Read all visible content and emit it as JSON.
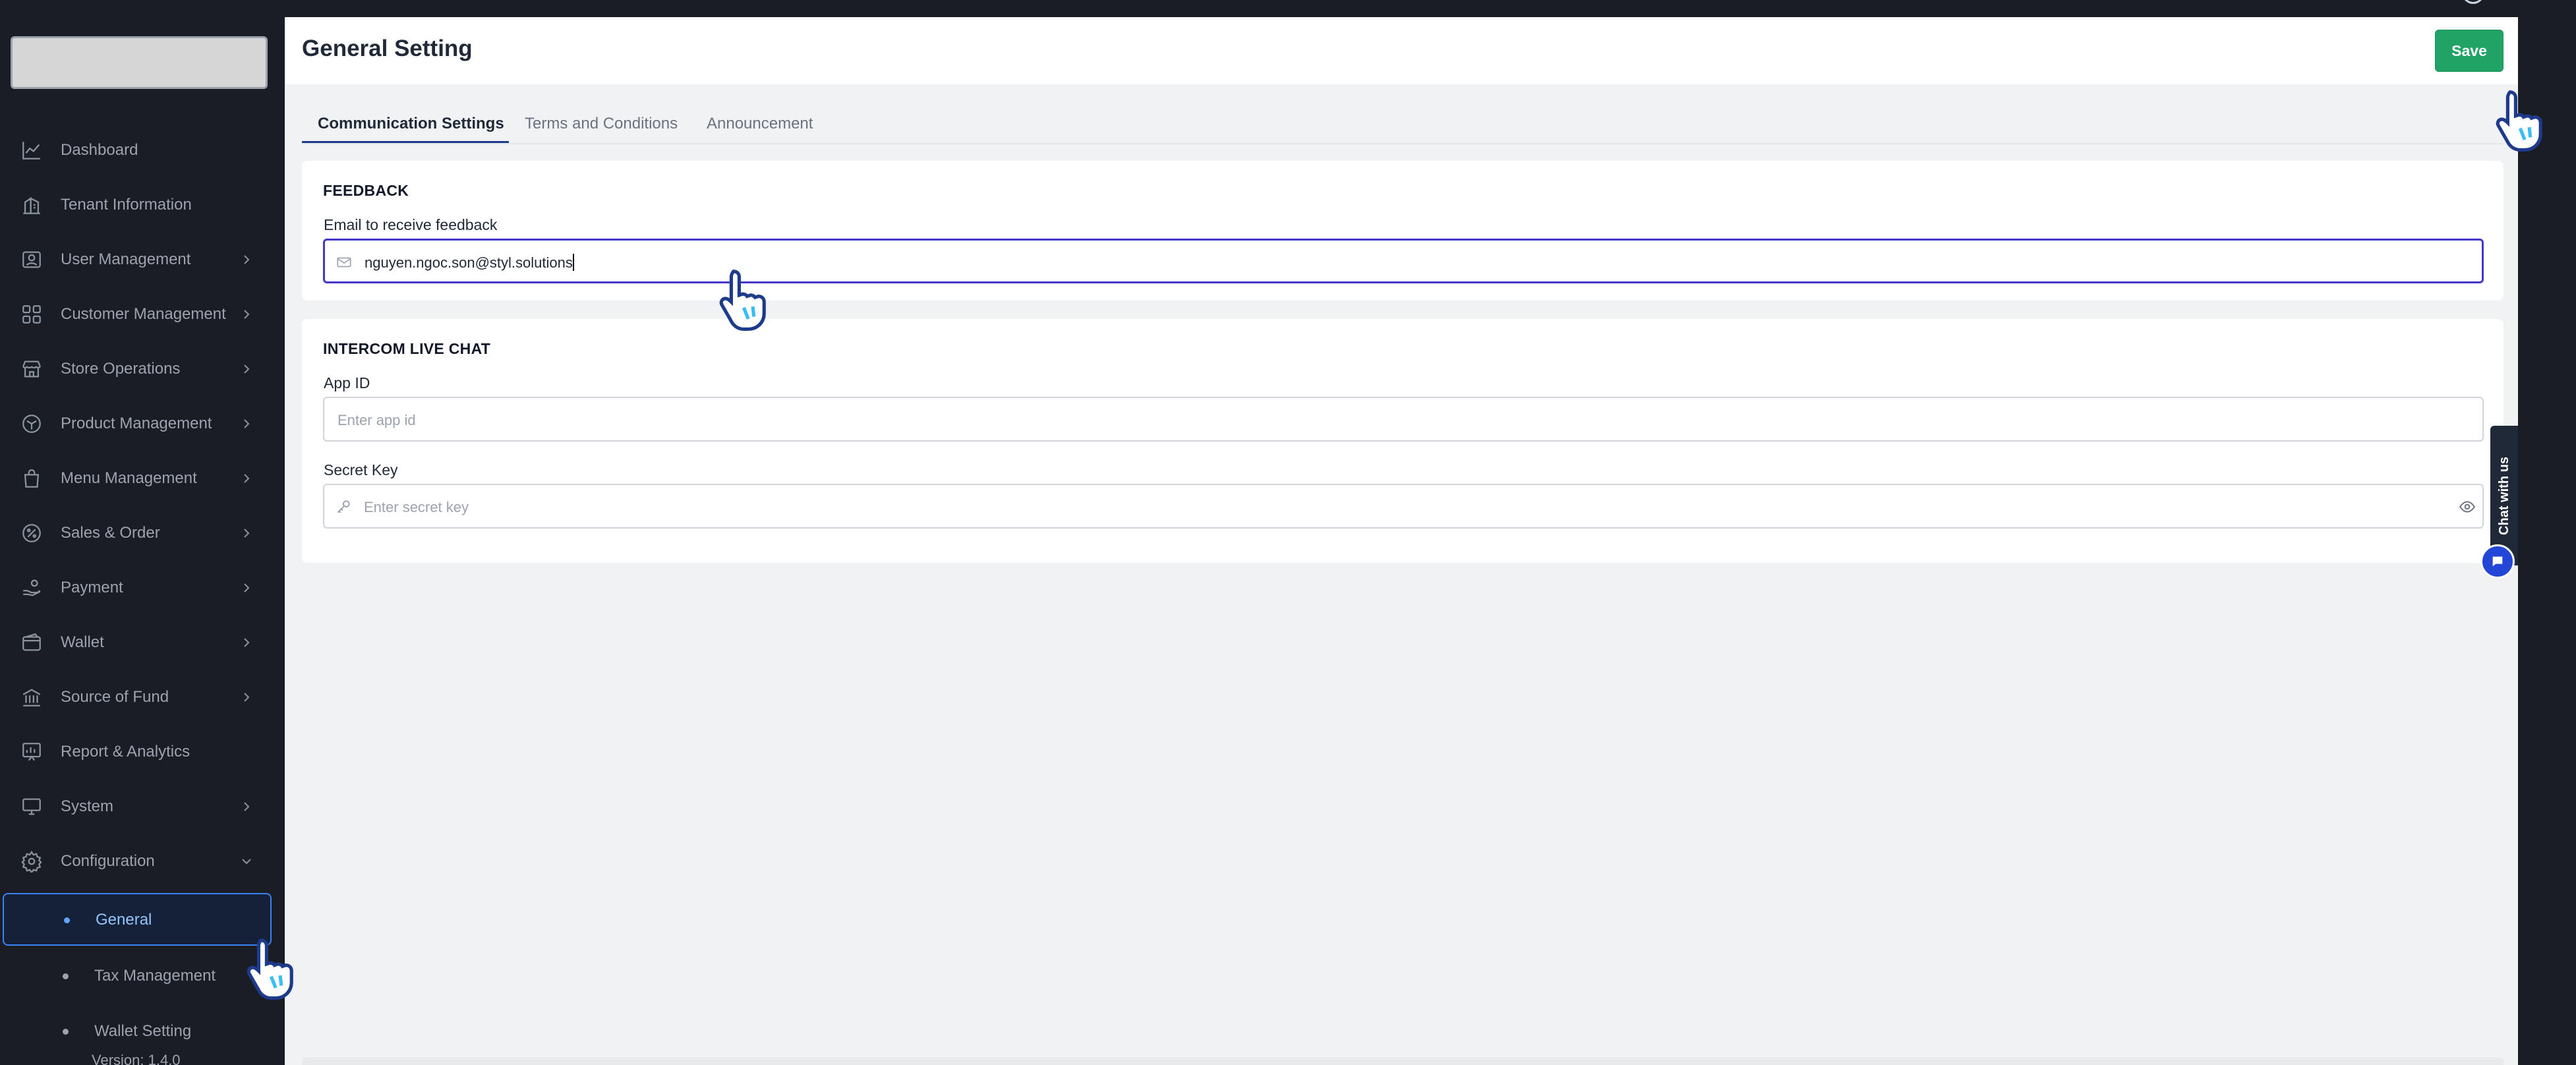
{
  "app": {
    "version": "Version: 1.4.0"
  },
  "sidebar": {
    "items": [
      {
        "label": "Dashboard",
        "icon": "chart-line-icon",
        "has_chevron": false
      },
      {
        "label": "Tenant Information",
        "icon": "building-icon",
        "has_chevron": false
      },
      {
        "label": "User Management",
        "icon": "user-card-icon",
        "has_chevron": true
      },
      {
        "label": "Customer Management",
        "icon": "grid-icon",
        "has_chevron": true
      },
      {
        "label": "Store Operations",
        "icon": "store-icon",
        "has_chevron": true
      },
      {
        "label": "Product Management",
        "icon": "box-icon",
        "has_chevron": true
      },
      {
        "label": "Menu Management",
        "icon": "bag-icon",
        "has_chevron": true
      },
      {
        "label": "Sales & Order",
        "icon": "tag-icon",
        "has_chevron": true
      },
      {
        "label": "Payment",
        "icon": "hand-coin-icon",
        "has_chevron": true
      },
      {
        "label": "Wallet",
        "icon": "wallet-icon",
        "has_chevron": true
      },
      {
        "label": "Source of Fund",
        "icon": "bank-icon",
        "has_chevron": true
      },
      {
        "label": "Report & Analytics",
        "icon": "report-icon",
        "has_chevron": false
      },
      {
        "label": "System",
        "icon": "monitor-icon",
        "has_chevron": true
      },
      {
        "label": "Configuration",
        "icon": "gear-icon",
        "has_chevron": true,
        "expanded": true
      }
    ],
    "sub_items": [
      {
        "label": "General",
        "active": true
      },
      {
        "label": "Tax Management",
        "active": false
      },
      {
        "label": "Wallet Setting",
        "active": false
      }
    ]
  },
  "header": {
    "title": "General Setting",
    "save_label": "Save"
  },
  "tabs": [
    {
      "label": "Communication Settings",
      "active": true
    },
    {
      "label": "Terms and Conditions",
      "active": false
    },
    {
      "label": "Announcement",
      "active": false
    }
  ],
  "feedback": {
    "section_title": "FEEDBACK",
    "email_label": "Email to receive feedback",
    "email_value": "nguyen.ngoc.son@styl.solutions",
    "icon": "mail-icon"
  },
  "intercom": {
    "section_title": "INTERCOM LIVE CHAT",
    "app_id_label": "App ID",
    "app_id_placeholder": "Enter app id",
    "secret_key_label": "Secret Key",
    "secret_key_placeholder": "Enter secret key",
    "key_icon": "key-icon",
    "reveal_icon": "eye-icon"
  },
  "chat_widget": {
    "label": "Chat with us",
    "icon": "chat-bubble-icon"
  },
  "colors": {
    "sidebar_bg": "#1a1d24",
    "main_bg": "#f1f2f4",
    "accent_blue": "#3b82f6",
    "save_green": "#21a366",
    "focus_border": "#4338ca",
    "chat_blue": "#2346d6"
  }
}
